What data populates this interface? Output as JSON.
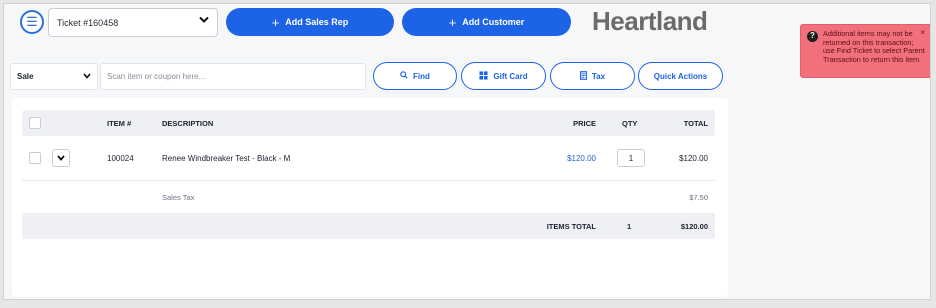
{
  "header": {
    "menu_icon": "hamburger-icon",
    "ticket_label": "Ticket #160458",
    "add_sales_rep_label": "Add Sales Rep",
    "add_customer_label": "Add Customer",
    "brand_name": "Heartland"
  },
  "toolbar": {
    "sale_mode": "Sale",
    "scan_placeholder": "Scan item or coupon here...",
    "find_label": "Find",
    "gift_card_label": "Gift Card",
    "tax_label": "Tax",
    "quick_actions_label": "Quick Actions"
  },
  "table": {
    "columns": {
      "item": "ITEM #",
      "description": "DESCRIPTION",
      "price": "PRICE",
      "qty": "QTY",
      "total": "TOTAL"
    },
    "rows": [
      {
        "item": "100024",
        "description": "Renee Windbreaker Test - Black - M",
        "price": "$120.00",
        "qty": "1",
        "total": "$120.00"
      }
    ],
    "sales_tax_label": "Sales Tax",
    "sales_tax_value": "$7.50",
    "items_total_label": "ITEMS TOTAL",
    "items_total_qty": "1",
    "items_total_value": "$120.00"
  },
  "toast": {
    "message": "Additional items may not be returned on this transaction; use Find Ticket to select Parent Transaction to return this item",
    "close_symbol": "×"
  },
  "colors": {
    "primary": "#1d63e5",
    "brand_text": "#6b6b6b",
    "toast_bg": "#f2707c"
  }
}
